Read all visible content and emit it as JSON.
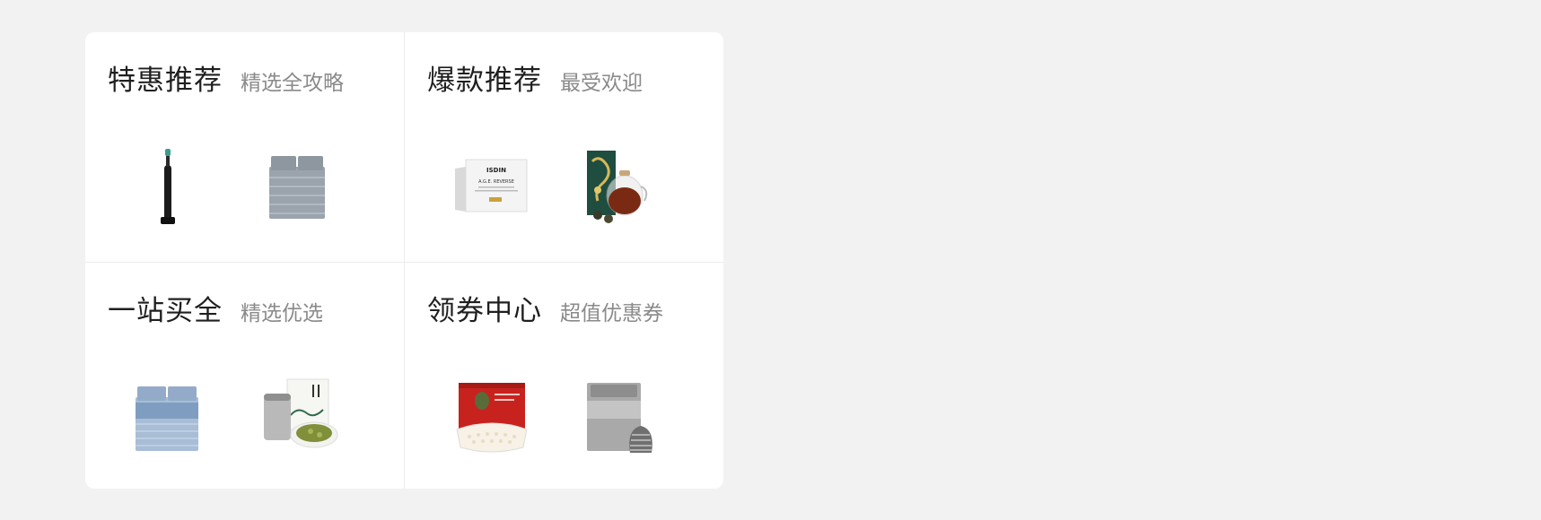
{
  "panels": [
    {
      "title": "特惠推荐",
      "subtitle": "精选全攻略",
      "products": [
        {
          "icon": "electric-toothbrush-icon"
        },
        {
          "icon": "gray-bedding-set-icon"
        }
      ]
    },
    {
      "title": "爆款推荐",
      "subtitle": "最受欢迎",
      "products": [
        {
          "icon": "isdin-serum-box-icon",
          "brand": "ISDIN",
          "text": "A.G.E. REVERSE"
        },
        {
          "icon": "tea-pot-set-icon"
        }
      ]
    },
    {
      "title": "一站买全",
      "subtitle": "精选优选",
      "products": [
        {
          "icon": "blue-bedding-set-icon"
        },
        {
          "icon": "tea-tin-gift-set-icon"
        }
      ]
    },
    {
      "title": "领券中心",
      "subtitle": "超值优惠券",
      "products": [
        {
          "icon": "latex-pillow-box-icon"
        },
        {
          "icon": "gray-bedding-bag-icon"
        }
      ]
    }
  ]
}
